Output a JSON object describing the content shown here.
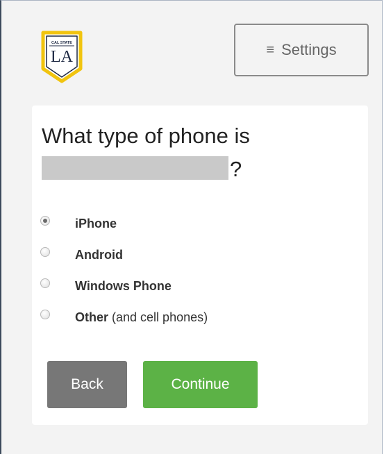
{
  "header": {
    "logo": {
      "top_text": "CAL STATE",
      "main_text": "LA",
      "colors": {
        "gold": "#f1c40f",
        "navy": "#1f2a44"
      }
    },
    "settings_button": {
      "icon": "hamburger-menu-icon",
      "label": "Settings"
    }
  },
  "question": {
    "prefix": "What type of phone is",
    "suffix": "?"
  },
  "options": [
    {
      "label": "iPhone",
      "note": "",
      "selected": true
    },
    {
      "label": "Android",
      "note": "",
      "selected": false
    },
    {
      "label": "Windows Phone",
      "note": "",
      "selected": false
    },
    {
      "label": "Other",
      "note": "(and cell phones)",
      "selected": false
    }
  ],
  "buttons": {
    "back_label": "Back",
    "continue_label": "Continue"
  },
  "colors": {
    "continue": "#5cb246",
    "back": "#777777"
  }
}
